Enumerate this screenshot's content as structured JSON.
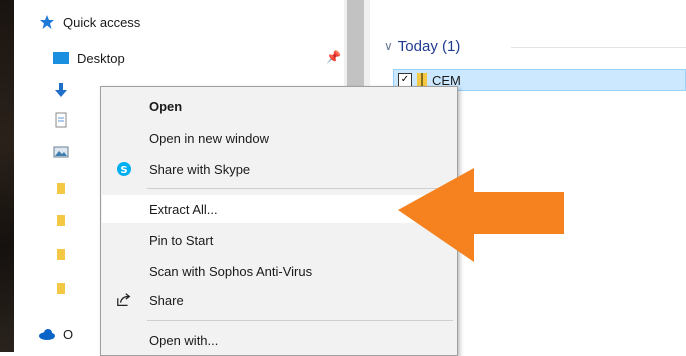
{
  "nav": {
    "quick_access": "Quick access",
    "items": [
      {
        "label": "Desktop",
        "pinned": true
      },
      {
        "label": "Downloads",
        "pinned": true
      },
      {
        "label": "",
        "pinned": false
      },
      {
        "label": "",
        "pinned": false
      },
      {
        "label": "",
        "pinned": false
      },
      {
        "label": "",
        "pinned": false
      },
      {
        "label": "",
        "pinned": false
      },
      {
        "label": "",
        "pinned": false
      }
    ],
    "onedrive_label": "O"
  },
  "content": {
    "group_header": "Today (1)",
    "file_name": "CEM",
    "file_checked": true
  },
  "context_menu": {
    "items": [
      {
        "label": "Open",
        "bold": true
      },
      {
        "label": "Open in new window"
      },
      {
        "label": "Share with Skype"
      },
      {
        "label": "Extract All...",
        "highlighted": true
      },
      {
        "label": "Pin to Start"
      },
      {
        "label": "Scan with Sophos Anti-Virus"
      },
      {
        "label": "Share"
      },
      {
        "label": "Open with..."
      }
    ]
  },
  "colors": {
    "accent_blue": "#1f3b8f",
    "selection_bg": "#cce8ff",
    "arrow_orange": "#f5821f",
    "skype_blue": "#00aff0"
  },
  "icons": {
    "quick_access": "star-icon",
    "desktop": "desktop-icon",
    "downloads": "download-arrow-icon",
    "onedrive": "cloud-icon",
    "skype": "skype-icon",
    "share": "share-icon",
    "folder": "folder-icon"
  }
}
